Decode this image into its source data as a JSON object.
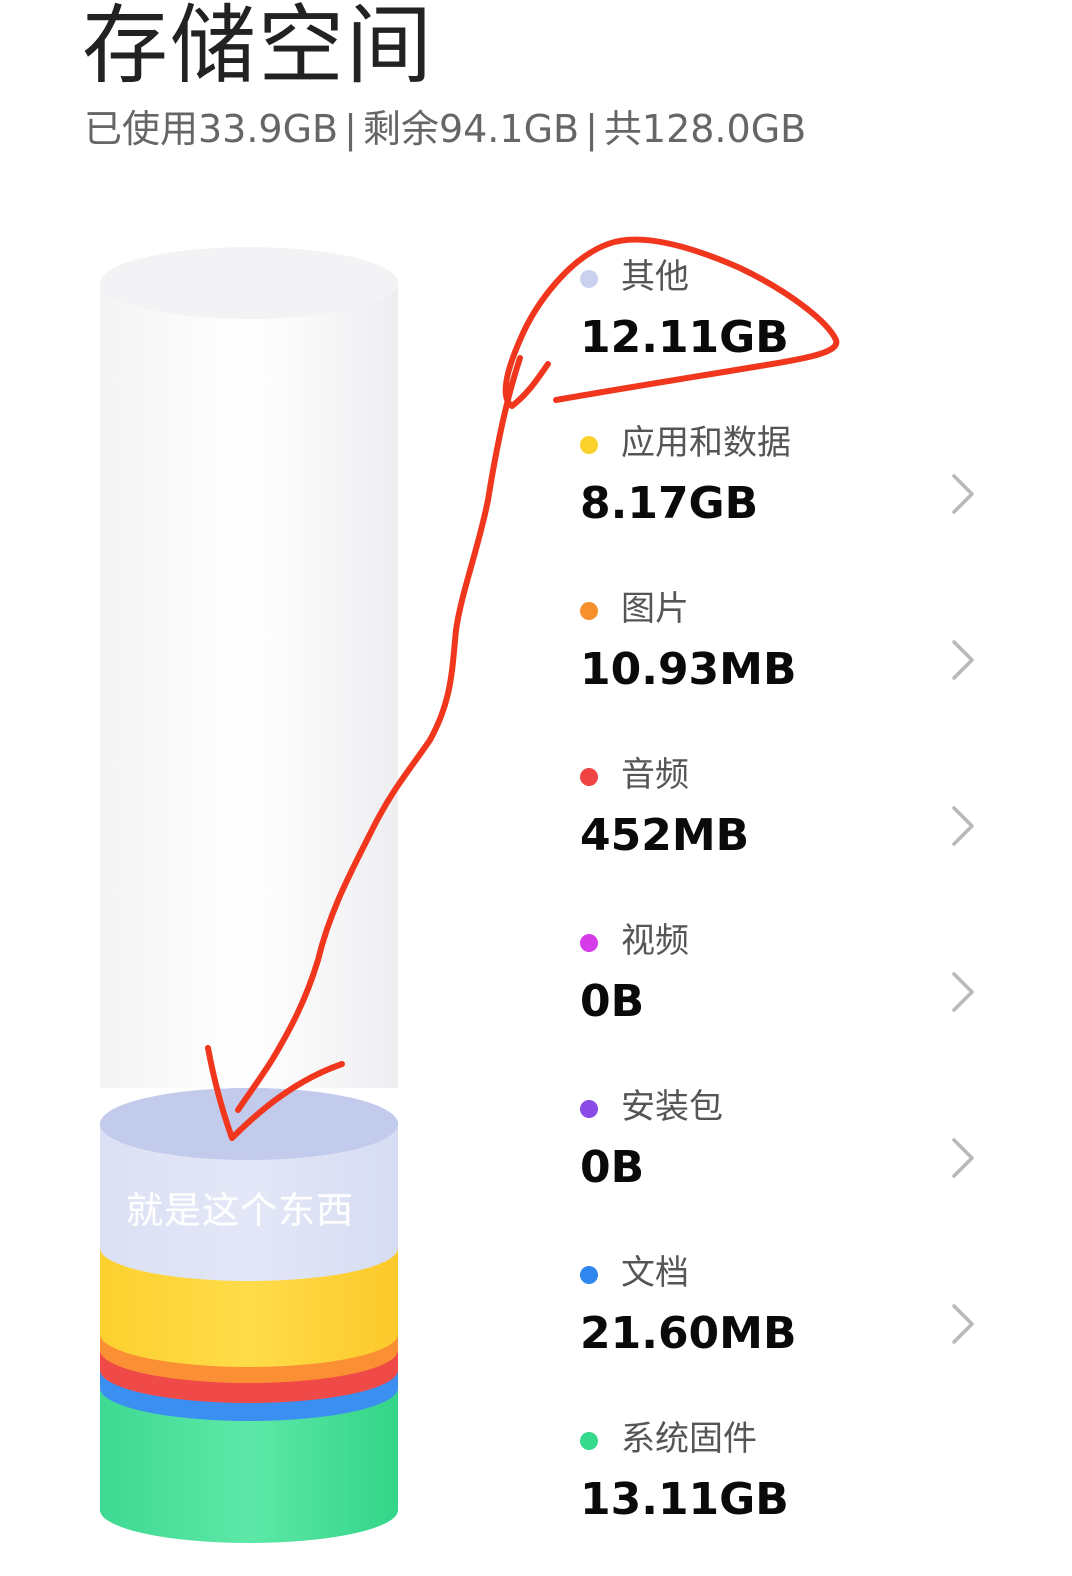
{
  "header": {
    "title": "存储空间",
    "used": "已使用33.9GB",
    "free": "剩余94.1GB",
    "total": "共128.0GB",
    "separator": "|"
  },
  "cylinder": {
    "overlay_label": "就是这个东西"
  },
  "categories": [
    {
      "name": "其他",
      "size": "12.11GB",
      "color": "#c9d1ee",
      "has_chevron": false
    },
    {
      "name": "应用和数据",
      "size": "8.17GB",
      "color": "#fbd12c",
      "has_chevron": true
    },
    {
      "name": "图片",
      "size": "10.93MB",
      "color": "#f7902c",
      "has_chevron": true
    },
    {
      "name": "音频",
      "size": "452MB",
      "color": "#ee4444",
      "has_chevron": true
    },
    {
      "name": "视频",
      "size": "0B",
      "color": "#d63be8",
      "has_chevron": true
    },
    {
      "name": "安装包",
      "size": "0B",
      "color": "#8a4be8",
      "has_chevron": true
    },
    {
      "name": "文档",
      "size": "21.60MB",
      "color": "#2f86ee",
      "has_chevron": true
    },
    {
      "name": "系统固件",
      "size": "13.11GB",
      "color": "#34d98c",
      "has_chevron": false
    }
  ],
  "colors": {
    "annotation": "#f0361c",
    "chevron": "#b8b8b8"
  }
}
